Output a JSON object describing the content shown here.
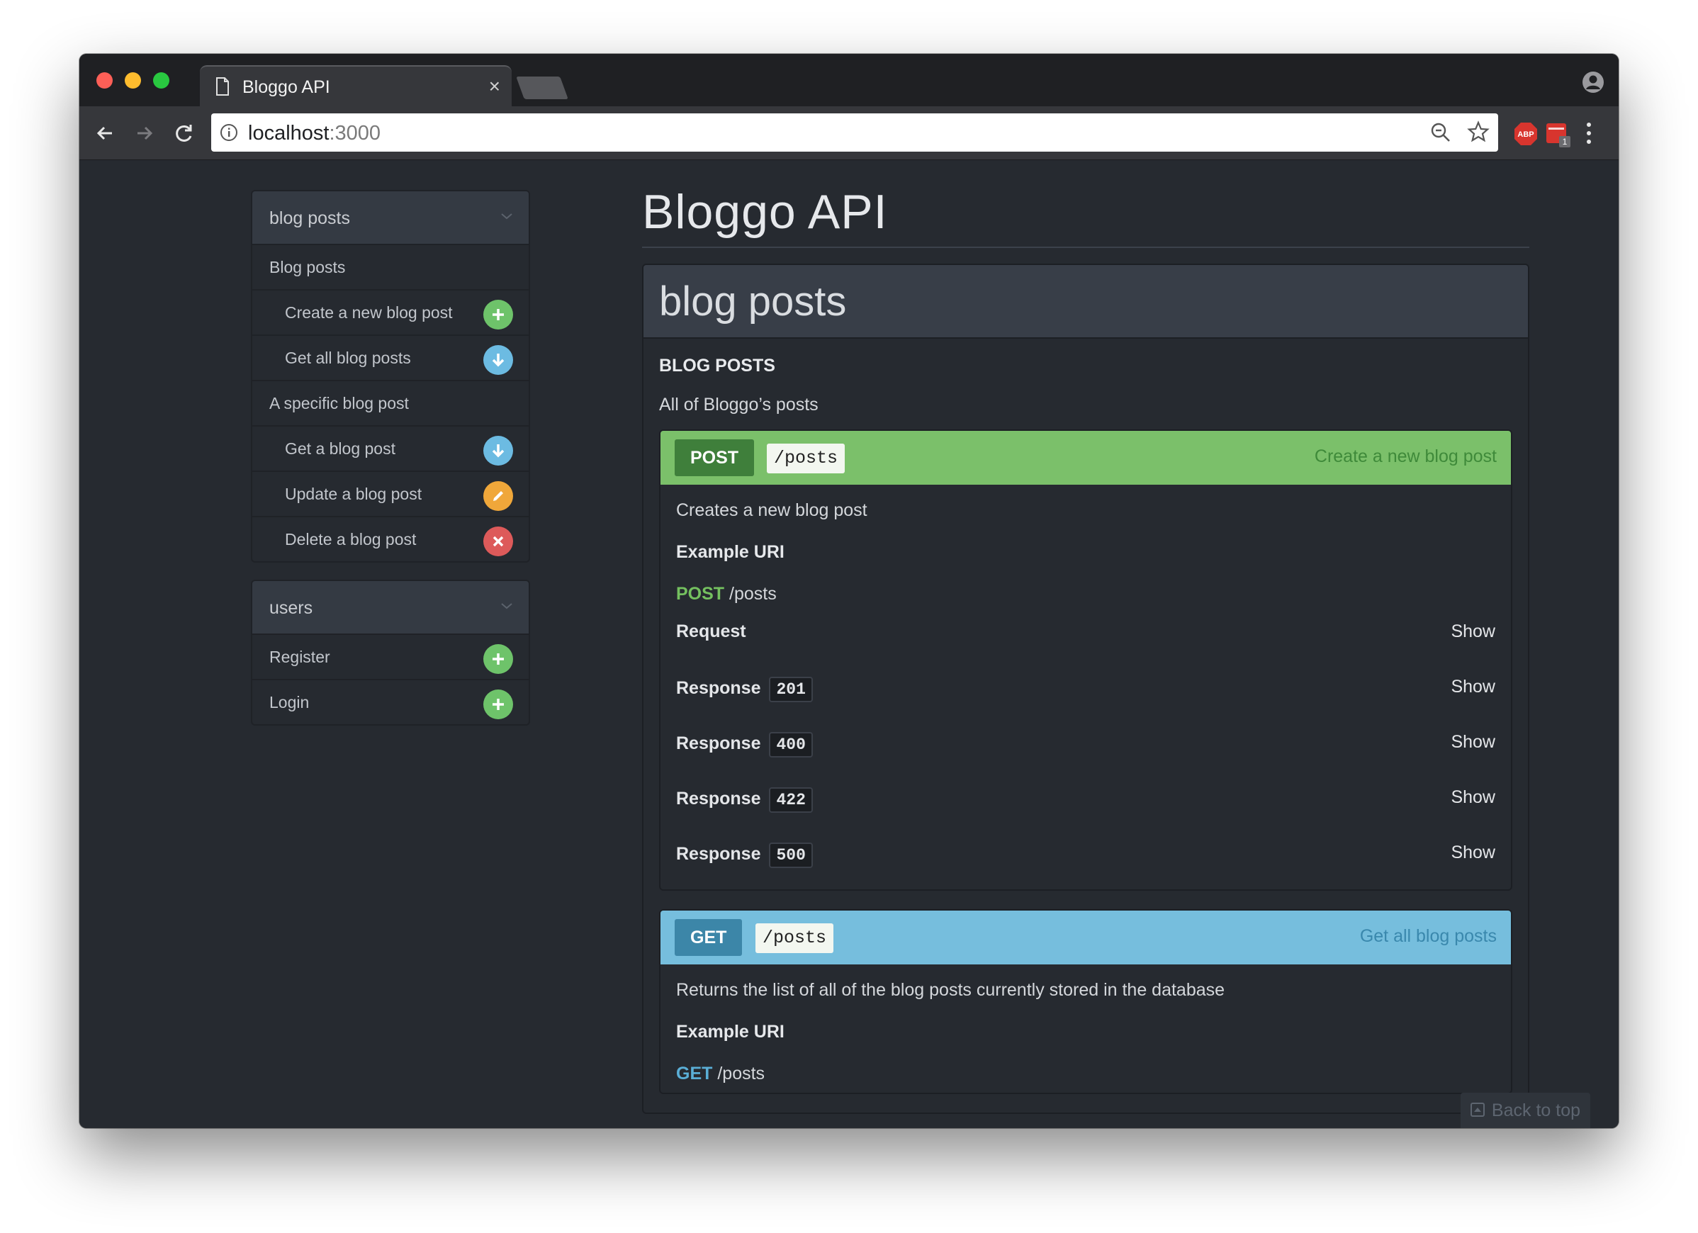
{
  "browser": {
    "tab_title": "Bloggo API",
    "tab_close": "×",
    "url_host": "localhost",
    "url_port": ":3000",
    "abp_label": "ABP",
    "ext_count": "1"
  },
  "sidebar": {
    "groups": [
      {
        "title": "blog posts",
        "items": [
          {
            "label": "Blog posts",
            "level": "section"
          },
          {
            "label": "Create a new blog post",
            "level": "sub",
            "badge": "plus-icon",
            "color": "#6ec36a"
          },
          {
            "label": "Get all blog posts",
            "level": "sub",
            "badge": "download-icon",
            "color": "#6cbbe2"
          },
          {
            "label": "A specific blog post",
            "level": "section"
          },
          {
            "label": "Get a blog post",
            "level": "sub",
            "badge": "download-icon",
            "color": "#6cbbe2"
          },
          {
            "label": "Update a blog post",
            "level": "sub",
            "badge": "pencil-icon",
            "color": "#f0a73a"
          },
          {
            "label": "Delete a blog post",
            "level": "sub",
            "badge": "close-icon",
            "color": "#dd5a5a"
          }
        ]
      },
      {
        "title": "users",
        "items": [
          {
            "label": "Register",
            "level": "section",
            "badge": "plus-icon",
            "color": "#6ec36a"
          },
          {
            "label": "Login",
            "level": "section",
            "badge": "plus-icon",
            "color": "#6ec36a"
          }
        ]
      }
    ]
  },
  "main": {
    "title": "Bloggo API",
    "resource": {
      "title": "blog posts",
      "group_name": "BLOG POSTS",
      "group_description": "All of Bloggo’s posts",
      "actions": [
        {
          "method": "POST",
          "uri": "/posts",
          "title": "Create a new blog post",
          "description": "Creates a new blog post",
          "example_label": "Example URI",
          "example_method": "POST",
          "example_path": " /posts",
          "rows": [
            {
              "label": "Request",
              "code": "",
              "show": "Show"
            },
            {
              "label": "Response",
              "code": "201",
              "show": "Show"
            },
            {
              "label": "Response",
              "code": "400",
              "show": "Show"
            },
            {
              "label": "Response",
              "code": "422",
              "show": "Show"
            },
            {
              "label": "Response",
              "code": "500",
              "show": "Show"
            }
          ]
        },
        {
          "method": "GET",
          "uri": "/posts",
          "title": "Get all blog posts",
          "description": "Returns the list of all of the blog posts currently stored in the database",
          "example_label": "Example URI",
          "example_method": "GET",
          "example_path": " /posts"
        }
      ]
    },
    "back_to_top": "Back to top"
  },
  "colors": {
    "post": "#7bc06a",
    "get": "#76bedd",
    "page_bg": "#262a30"
  }
}
